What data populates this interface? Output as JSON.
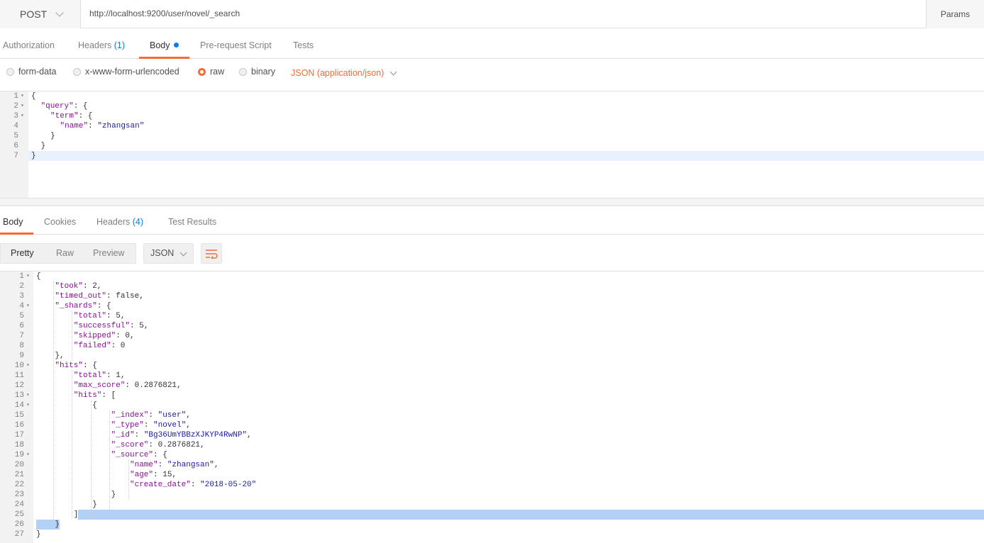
{
  "request": {
    "method": "POST",
    "url": "http://localhost:9200/user/novel/_search",
    "params_label": "Params"
  },
  "request_tabs": [
    {
      "label": "Authorization"
    },
    {
      "label": "Headers",
      "count": "(1)"
    },
    {
      "label": "Body"
    },
    {
      "label": "Pre-request Script"
    },
    {
      "label": "Tests"
    }
  ],
  "body_types": {
    "options": [
      "form-data",
      "x-www-form-urlencoded",
      "raw",
      "binary"
    ],
    "selected": "raw",
    "content_type": "JSON (application/json)"
  },
  "request_body": [
    {
      "n": "1",
      "fold": true,
      "tokens": [
        [
          "p",
          "{"
        ]
      ]
    },
    {
      "n": "2",
      "fold": true,
      "indent": 1,
      "tokens": [
        [
          "k",
          "\"query\""
        ],
        [
          "p",
          ": {"
        ]
      ]
    },
    {
      "n": "3",
      "fold": true,
      "indent": 2,
      "tokens": [
        [
          "k",
          "\"term\""
        ],
        [
          "p",
          ": {"
        ]
      ]
    },
    {
      "n": "4",
      "fold": false,
      "indent": 3,
      "tokens": [
        [
          "k",
          "\"name\""
        ],
        [
          "p",
          ": "
        ],
        [
          "s",
          "\"zhangsan\""
        ]
      ]
    },
    {
      "n": "5",
      "fold": false,
      "indent": 2,
      "tokens": [
        [
          "p",
          "}"
        ]
      ]
    },
    {
      "n": "6",
      "fold": false,
      "indent": 1,
      "tokens": [
        [
          "p",
          "}"
        ]
      ]
    },
    {
      "n": "7",
      "fold": false,
      "indent": 0,
      "tokens": [
        [
          "p",
          "}"
        ]
      ]
    }
  ],
  "response_tabs": [
    {
      "label": "Body"
    },
    {
      "label": "Cookies"
    },
    {
      "label": "Headers",
      "count": "(4)"
    },
    {
      "label": "Test Results"
    }
  ],
  "response_view": {
    "modes": [
      "Pretty",
      "Raw",
      "Preview"
    ],
    "active_mode": "Pretty",
    "format": "JSON",
    "wrap_icon": "wrap-lines-icon"
  },
  "response_body": [
    {
      "n": "1",
      "fold": true,
      "indent": 0,
      "tokens": [
        [
          "p",
          "{"
        ]
      ]
    },
    {
      "n": "2",
      "indent": 1,
      "tokens": [
        [
          "k",
          "\"took\""
        ],
        [
          "p",
          ": 2,"
        ]
      ]
    },
    {
      "n": "3",
      "indent": 1,
      "tokens": [
        [
          "k",
          "\"timed_out\""
        ],
        [
          "p",
          ": false,"
        ]
      ]
    },
    {
      "n": "4",
      "fold": true,
      "indent": 1,
      "tokens": [
        [
          "k",
          "\"_shards\""
        ],
        [
          "p",
          ": {"
        ]
      ]
    },
    {
      "n": "5",
      "indent": 2,
      "tokens": [
        [
          "k",
          "\"total\""
        ],
        [
          "p",
          ": 5,"
        ]
      ]
    },
    {
      "n": "6",
      "indent": 2,
      "tokens": [
        [
          "k",
          "\"successful\""
        ],
        [
          "p",
          ": 5,"
        ]
      ]
    },
    {
      "n": "7",
      "indent": 2,
      "tokens": [
        [
          "k",
          "\"skipped\""
        ],
        [
          "p",
          ": 0,"
        ]
      ]
    },
    {
      "n": "8",
      "indent": 2,
      "tokens": [
        [
          "k",
          "\"failed\""
        ],
        [
          "p",
          ": 0"
        ]
      ]
    },
    {
      "n": "9",
      "indent": 1,
      "tokens": [
        [
          "p",
          "},"
        ]
      ]
    },
    {
      "n": "10",
      "fold": true,
      "indent": 1,
      "tokens": [
        [
          "k",
          "\"hits\""
        ],
        [
          "p",
          ": {"
        ]
      ]
    },
    {
      "n": "11",
      "indent": 2,
      "tokens": [
        [
          "k",
          "\"total\""
        ],
        [
          "p",
          ": 1,"
        ]
      ]
    },
    {
      "n": "12",
      "indent": 2,
      "tokens": [
        [
          "k",
          "\"max_score\""
        ],
        [
          "p",
          ": 0.2876821,"
        ]
      ]
    },
    {
      "n": "13",
      "fold": true,
      "indent": 2,
      "tokens": [
        [
          "k",
          "\"hits\""
        ],
        [
          "p",
          ": ["
        ]
      ]
    },
    {
      "n": "14",
      "fold": true,
      "indent": 3,
      "tokens": [
        [
          "p",
          "{"
        ]
      ]
    },
    {
      "n": "15",
      "indent": 4,
      "tokens": [
        [
          "k",
          "\"_index\""
        ],
        [
          "p",
          ": "
        ],
        [
          "s",
          "\"user\""
        ],
        [
          "p",
          ","
        ]
      ]
    },
    {
      "n": "16",
      "indent": 4,
      "tokens": [
        [
          "k",
          "\"_type\""
        ],
        [
          "p",
          ": "
        ],
        [
          "s",
          "\"novel\""
        ],
        [
          "p",
          ","
        ]
      ]
    },
    {
      "n": "17",
      "indent": 4,
      "tokens": [
        [
          "k",
          "\"_id\""
        ],
        [
          "p",
          ": "
        ],
        [
          "s",
          "\"Bg36UmYBBzXJKYP4RwNP\""
        ],
        [
          "p",
          ","
        ]
      ]
    },
    {
      "n": "18",
      "indent": 4,
      "tokens": [
        [
          "k",
          "\"_score\""
        ],
        [
          "p",
          ": 0.2876821,"
        ]
      ]
    },
    {
      "n": "19",
      "fold": true,
      "indent": 4,
      "tokens": [
        [
          "k",
          "\"_source\""
        ],
        [
          "p",
          ": {"
        ]
      ]
    },
    {
      "n": "20",
      "indent": 5,
      "tokens": [
        [
          "k",
          "\"name\""
        ],
        [
          "p",
          ": "
        ],
        [
          "s",
          "\"zhangsan\""
        ],
        [
          "p",
          ","
        ]
      ]
    },
    {
      "n": "21",
      "indent": 5,
      "tokens": [
        [
          "k",
          "\"age\""
        ],
        [
          "p",
          ": 15,"
        ]
      ]
    },
    {
      "n": "22",
      "indent": 5,
      "tokens": [
        [
          "k",
          "\"create_date\""
        ],
        [
          "p",
          ": "
        ],
        [
          "s",
          "\"2018-05-20\""
        ]
      ]
    },
    {
      "n": "23",
      "indent": 4,
      "tokens": [
        [
          "p",
          "}"
        ]
      ]
    },
    {
      "n": "24",
      "indent": 3,
      "tokens": [
        [
          "p",
          "}"
        ]
      ]
    },
    {
      "n": "25",
      "indent": 2,
      "tokens": [
        [
          "p",
          "]"
        ]
      ]
    },
    {
      "n": "26",
      "indent": 1,
      "tokens": [
        [
          "p",
          "}"
        ]
      ]
    },
    {
      "n": "27",
      "indent": 0,
      "tokens": [
        [
          "p",
          "}"
        ]
      ]
    }
  ],
  "colors": {
    "accent": "#f26b3a",
    "link_blue": "#097bed",
    "json_key": "#871094",
    "json_string": "#1a1aa6",
    "selection": "#b3d1f7"
  }
}
